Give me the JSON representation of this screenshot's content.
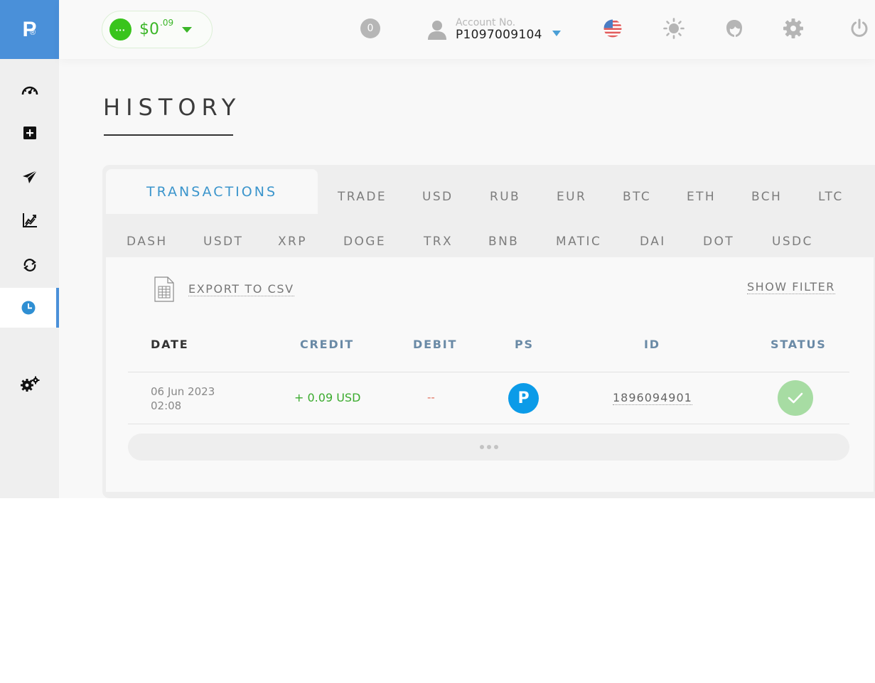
{
  "logo": {
    "letter": "P",
    "mark": "®"
  },
  "sidebar": {
    "items": [
      {
        "icon": "dashboard-gauge-icon"
      },
      {
        "icon": "plus-square-icon"
      },
      {
        "icon": "send-plane-icon"
      },
      {
        "icon": "chart-trend-icon"
      },
      {
        "icon": "exchange-arrows-icon"
      },
      {
        "icon": "clock-icon",
        "active": true
      },
      {
        "icon": "settings-gears-icon"
      }
    ]
  },
  "header": {
    "balance": {
      "amount": "$0",
      "cents": ".09",
      "dot_label": "···"
    },
    "notifications": "0",
    "account": {
      "label": "Account No.",
      "number": "P1097009104"
    },
    "icons": [
      "us-flag-icon",
      "sun-icon",
      "support-agent-icon",
      "gear-icon",
      "power-icon"
    ]
  },
  "page": {
    "title": "HISTORY"
  },
  "tabs": {
    "active": "TRANSACTIONS",
    "row1": [
      "TRADE",
      "USD",
      "RUB",
      "EUR",
      "BTC",
      "ETH",
      "BCH",
      "LTC"
    ],
    "row2": [
      "DASH",
      "USDT",
      "XRP",
      "DOGE",
      "TRX",
      "BNB",
      "MATIC",
      "DAI",
      "DOT",
      "USDC"
    ]
  },
  "toolbar": {
    "export_label": "EXPORT TO CSV",
    "filter_label": "SHOW FILTER"
  },
  "table": {
    "headers": [
      "DATE",
      "CREDIT",
      "DEBIT",
      "PS",
      "ID",
      "STATUS"
    ],
    "rows": [
      {
        "date": "06 Jun 2023",
        "time": "02:08",
        "credit": "+ 0.09 USD",
        "debit": "--",
        "ps": "P",
        "id": "1896094901",
        "status": "success"
      }
    ]
  },
  "colors": {
    "accent": "#4a90d9",
    "balance_green": "#39c41c",
    "credit_green": "#3bab2e",
    "debit_red": "#e06f5a",
    "ps_blue": "#0b9be8",
    "status_green": "#a7dca3",
    "header_text": "#6a8aa6"
  }
}
